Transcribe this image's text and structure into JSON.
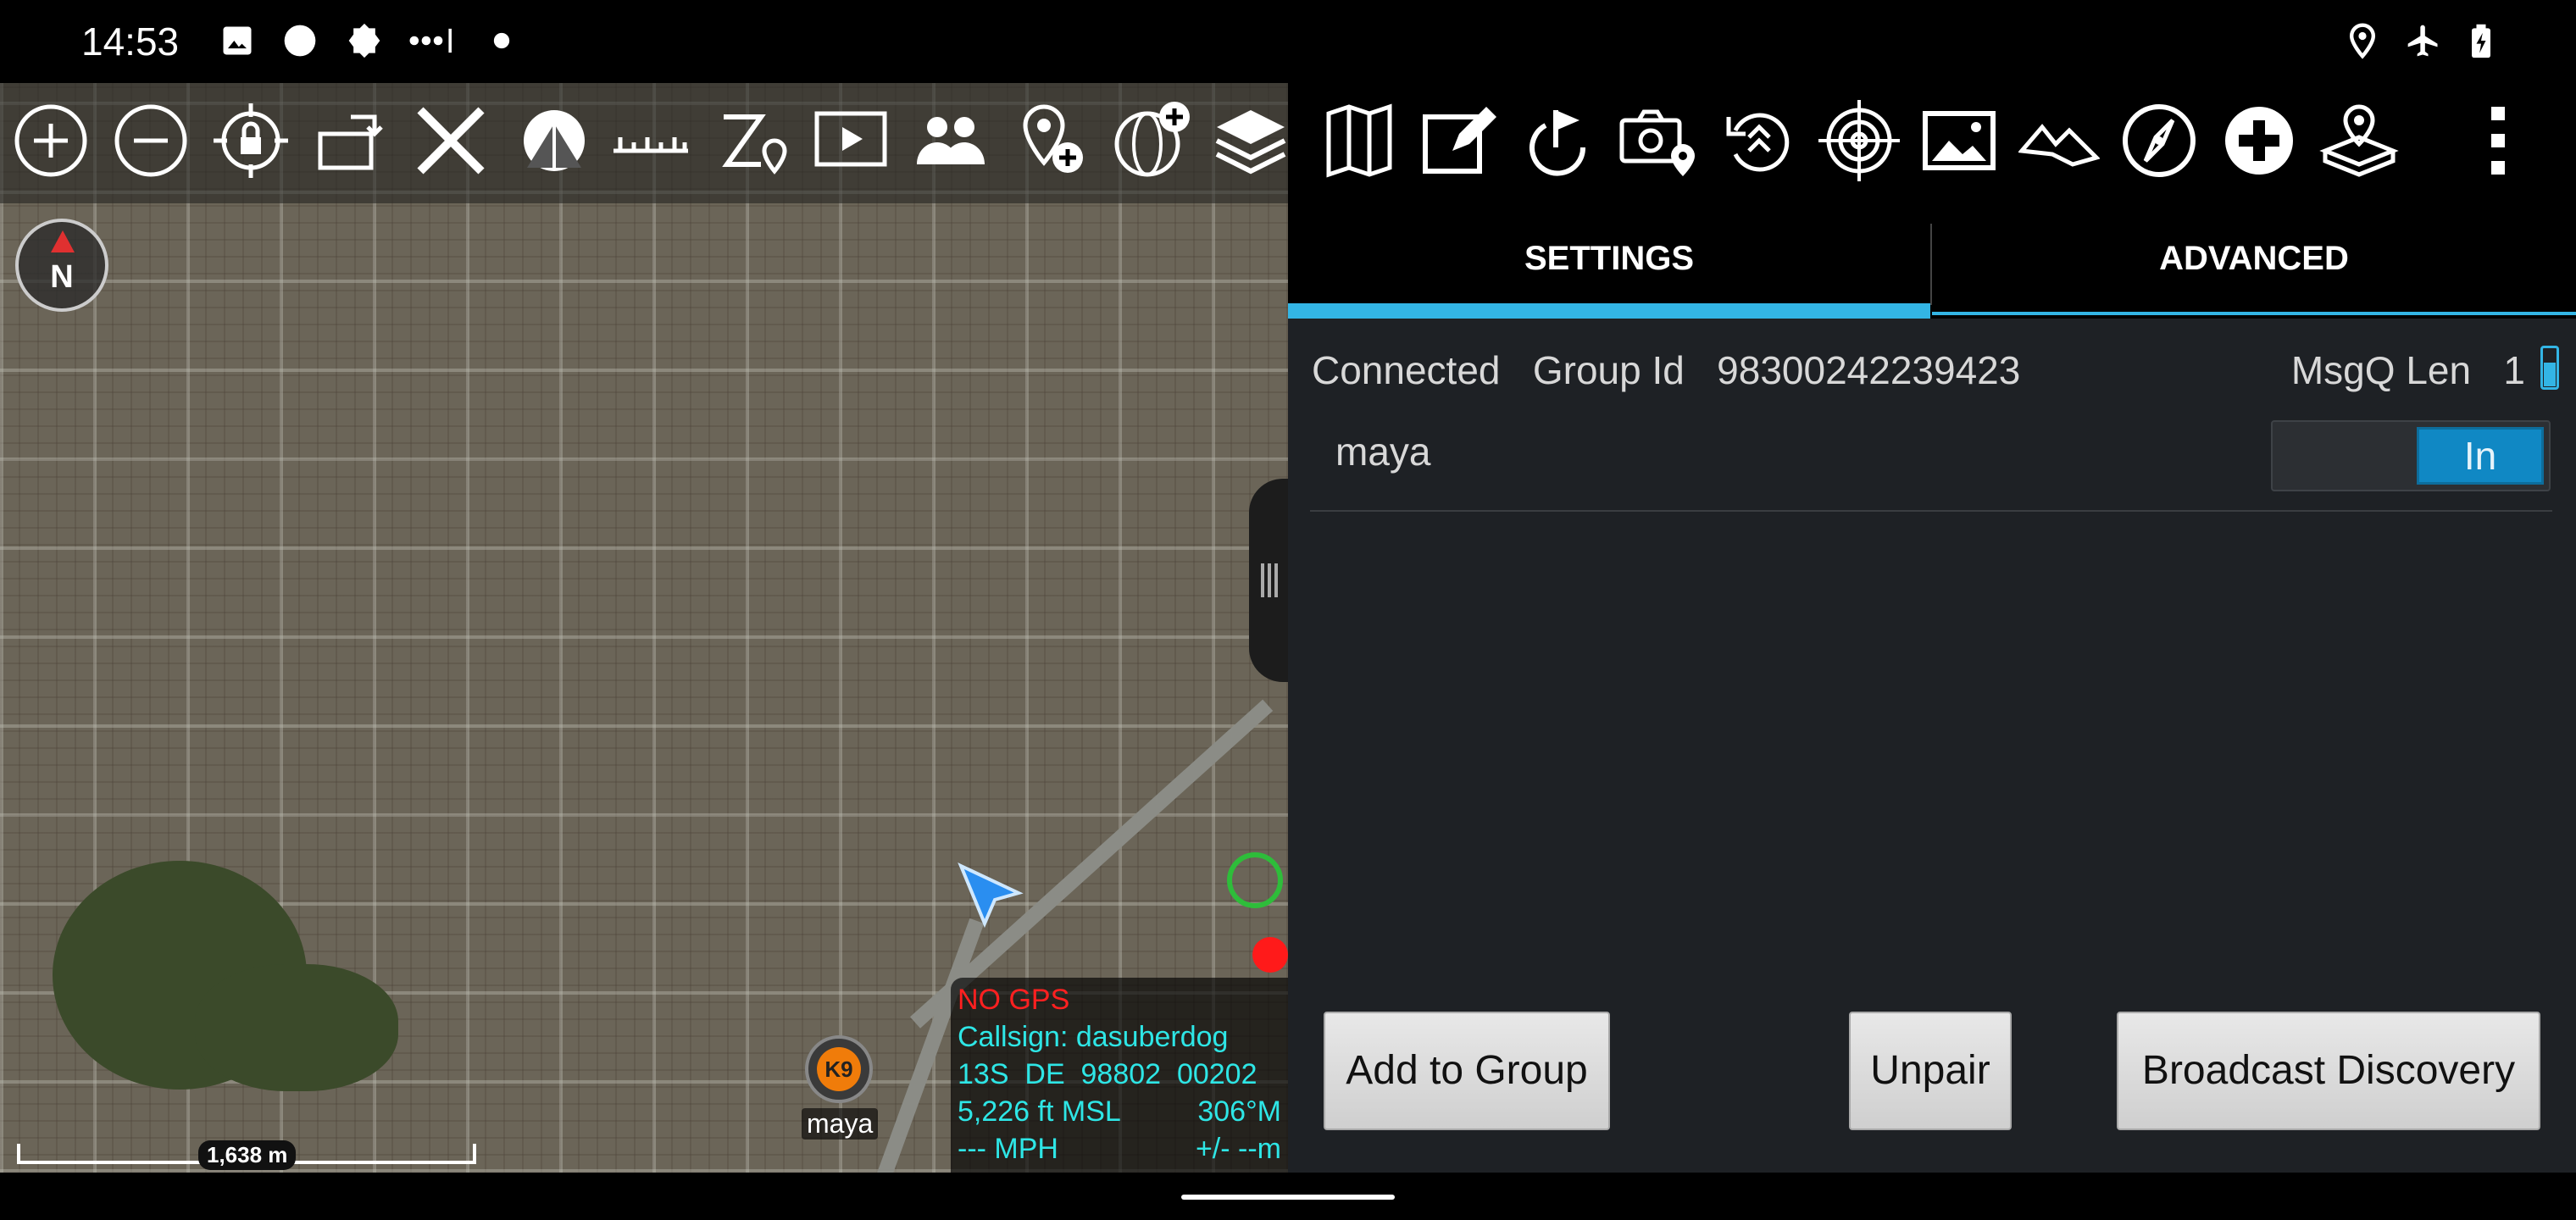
{
  "status_bar": {
    "time": "14:53",
    "left_icons": [
      "image-icon",
      "circle-icon",
      "badge-icon",
      "signal-dots-icon",
      "dot-icon"
    ],
    "right_icons": [
      "location-icon",
      "airplane-icon",
      "battery-charging-icon"
    ]
  },
  "toolbar": {
    "icons": [
      "zoom-in-icon",
      "zoom-out-icon",
      "lock-location-icon",
      "rotate-icon",
      "close-x-icon",
      "tent-icon",
      "ruler-icon",
      "route-icon",
      "video-icon",
      "contacts-icon",
      "add-point-icon",
      "globe-add-icon",
      "layers-icon",
      "map-icon",
      "edit-icon",
      "rotate-flag-icon",
      "camera-location-icon",
      "rewind-icon",
      "target-icon",
      "image-gallery-icon",
      "terrain-icon",
      "compass-icon",
      "medical-icon",
      "map-pin-box-icon",
      "overflow-menu-icon"
    ]
  },
  "map": {
    "compass_label": "N",
    "scale_label": "1,638 m",
    "k9_badge": "K9",
    "k9_label": "maya",
    "info": {
      "no_gps": "NO GPS",
      "callsign": "Callsign: dasuberdog",
      "grid": "13S  DE  98802  00202",
      "altitude": "5,226 ft MSL",
      "heading": "306°M",
      "speed": "--- MPH",
      "accuracy": "+/- --m"
    }
  },
  "panel": {
    "tabs": [
      {
        "label": "SETTINGS",
        "active": true
      },
      {
        "label": "ADVANCED",
        "active": false
      }
    ],
    "status_line": "Connected   Group Id   98300242239423",
    "msgq": "MsgQ Len   1",
    "device_name": "maya",
    "toggle_label": "In",
    "buttons": {
      "add": "Add to Group",
      "unpair": "Unpair",
      "broadcast": "Broadcast Discovery"
    }
  },
  "colors": {
    "accent": "#33b5e5",
    "toggle_on": "#1088c4",
    "alert": "#ff2020",
    "info_text": "#2ee6e6"
  }
}
